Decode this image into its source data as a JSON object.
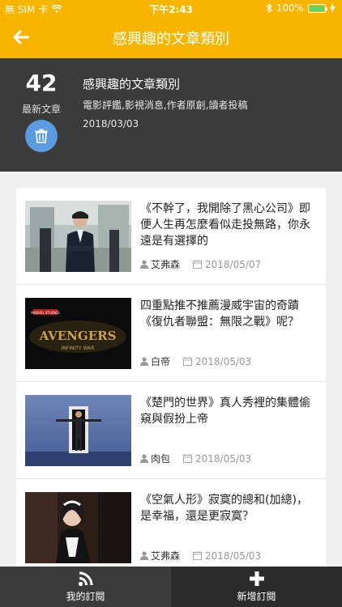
{
  "status": {
    "carrier": "無 SIM 卡",
    "time": "下午2:43",
    "battery": "100%"
  },
  "header": {
    "title": "感興趣的文章類別"
  },
  "category": {
    "count": "42",
    "count_label": "最新文章",
    "title": "感興趣的文章類別",
    "tags": "電影評鑑,影視消息,作者原創,讀者投稿",
    "date": "2018/03/03"
  },
  "articles": [
    {
      "title": "《不幹了，我開除了黑心公司》即便人生再怎麼看似走投無路，你永遠是有選擇的",
      "author": "艾弗森",
      "date": "2018/05/07"
    },
    {
      "title": "四重點推不推薦漫威宇宙的奇蹟《復仇者聯盟：無限之戰》呢？",
      "author": "白帝",
      "date": "2018/05/03",
      "poster_brand": "MARVEL STUDIOS",
      "poster_title": "AVENGERS",
      "poster_subtitle": "INFINITY WAR"
    },
    {
      "title": "《楚門的世界》真人秀裡的集體偷窺與假扮上帝",
      "author": "肉包",
      "date": "2018/05/03"
    },
    {
      "title": "《空氣人形》寂寞的總和(加總)，是幸福，還是更寂寞？",
      "author": "艾弗森",
      "date": "2018/05/03"
    }
  ],
  "tabs": [
    {
      "label": "我的訂閱",
      "icon": "rss-icon",
      "active": true
    },
    {
      "label": "新增訂閱",
      "icon": "plus-icon",
      "active": false
    }
  ],
  "colors": {
    "brand": "#f7b500",
    "panel": "#3b3b3b",
    "trash_button": "#5b9be0"
  }
}
